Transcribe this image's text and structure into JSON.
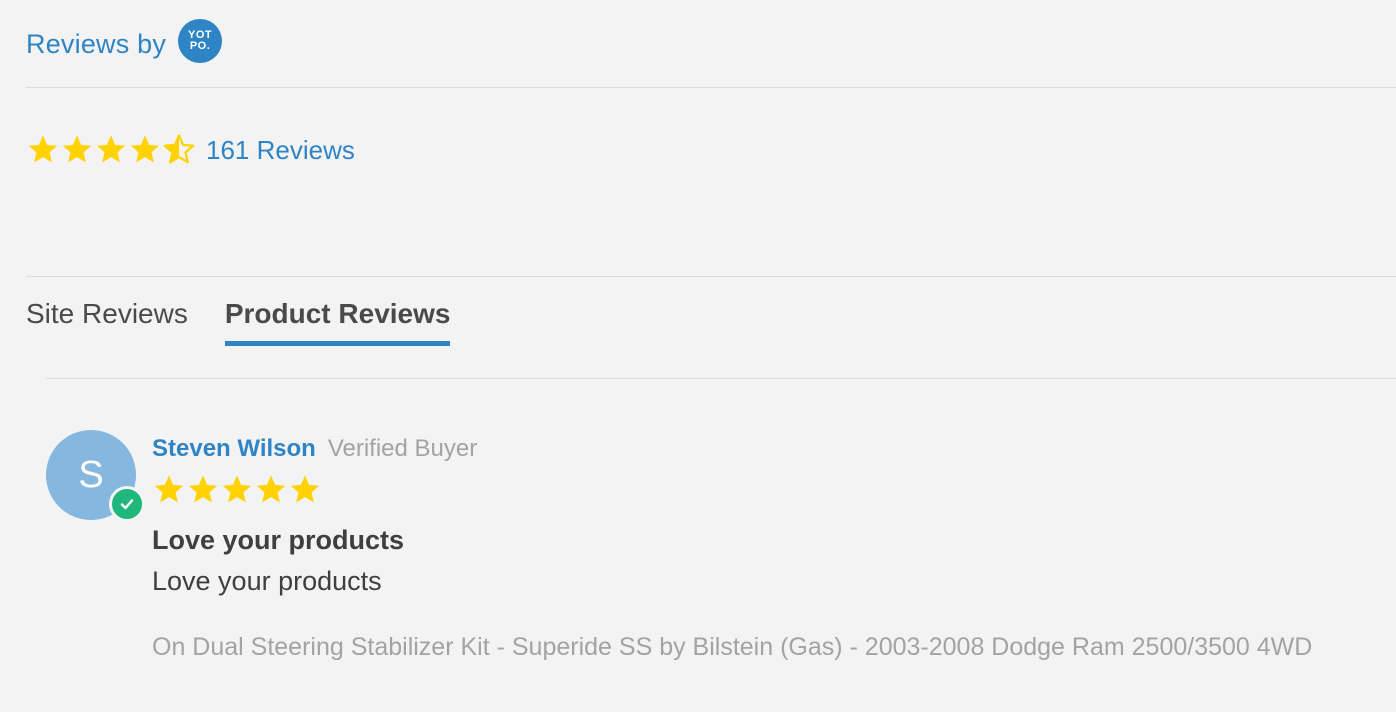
{
  "header": {
    "reviews_by_label": "Reviews by",
    "logo_line1": "YOT",
    "logo_line2": "PO."
  },
  "summary": {
    "rating": 4.5,
    "total_reviews_label": "161 Reviews"
  },
  "tabs": [
    {
      "label": "Site Reviews",
      "active": false
    },
    {
      "label": "Product Reviews",
      "active": true
    }
  ],
  "review": {
    "avatar_initial": "S",
    "author": "Steven Wilson",
    "buyer_status": "Verified Buyer",
    "rating": 5,
    "title": "Love your products",
    "content": "Love your products",
    "product": "On Dual Steering Stabilizer Kit - Superide SS by Bilstein (Gas) - 2003-2008 Dodge Ram 2500/3500 4WD"
  },
  "colors": {
    "accent": "#2f84c6",
    "star": "#ffd200",
    "verified": "#1fb77b",
    "avatar": "#85b7df"
  },
  "icons": {
    "star_full": "star-icon",
    "star_half": "half-star-icon",
    "verified": "check-icon"
  }
}
